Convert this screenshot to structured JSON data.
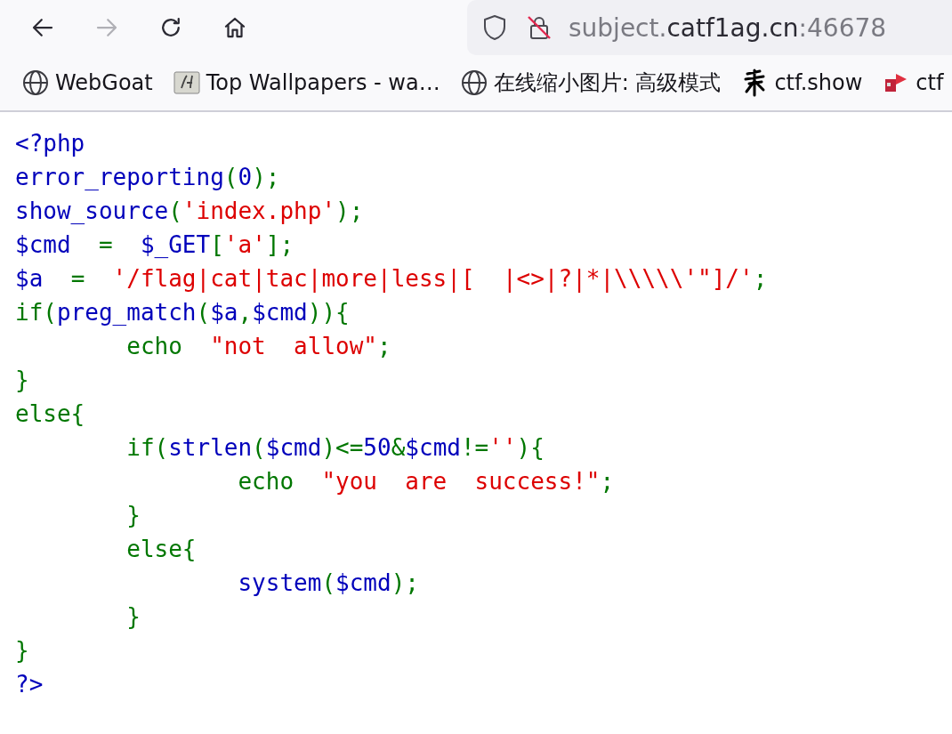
{
  "toolbar": {
    "nav_buttons": [
      {
        "kind": "back",
        "disabled": false
      },
      {
        "kind": "forward",
        "disabled": true
      },
      {
        "kind": "reload",
        "disabled": false
      },
      {
        "kind": "home",
        "disabled": false
      }
    ],
    "address": {
      "insecure": true,
      "prefix": "subject.",
      "host": "catf1ag.cn",
      "port": ":46678"
    }
  },
  "bookmarks": [
    {
      "kind": "globe",
      "label": "WebGoat"
    },
    {
      "kind": "tile",
      "label": "Top Wallpapers - wa…"
    },
    {
      "kind": "globe",
      "label": "在线缩小图片: 高级模式"
    },
    {
      "kind": "glyph",
      "label": "ctf.show"
    },
    {
      "kind": "flag",
      "label": "ctf"
    }
  ],
  "source": [
    [
      {
        "kind": "default",
        "text": "<?php"
      }
    ],
    [
      {
        "kind": "default",
        "text": "error_reporting"
      },
      {
        "kind": "keyword",
        "text": "("
      },
      {
        "kind": "default",
        "text": "0"
      },
      {
        "kind": "keyword",
        "text": ");"
      }
    ],
    [
      {
        "kind": "default",
        "text": "show_source"
      },
      {
        "kind": "keyword",
        "text": "("
      },
      {
        "kind": "string",
        "text": "'index.php'"
      },
      {
        "kind": "keyword",
        "text": ");"
      }
    ],
    [
      {
        "kind": "default",
        "text": "$cmd  "
      },
      {
        "kind": "keyword",
        "text": "=  "
      },
      {
        "kind": "default",
        "text": "$_GET"
      },
      {
        "kind": "keyword",
        "text": "["
      },
      {
        "kind": "string",
        "text": "'a'"
      },
      {
        "kind": "keyword",
        "text": "];"
      }
    ],
    [
      {
        "kind": "default",
        "text": "$a  "
      },
      {
        "kind": "keyword",
        "text": "=  "
      },
      {
        "kind": "string",
        "text": "'/flag|cat|tac|more|less|[  |<>|?|*|\\\\\\\\\\'\"]/'"
      },
      {
        "kind": "keyword",
        "text": ";"
      }
    ],
    [
      {
        "kind": "keyword",
        "text": "if("
      },
      {
        "kind": "default",
        "text": "preg_match"
      },
      {
        "kind": "keyword",
        "text": "("
      },
      {
        "kind": "default",
        "text": "$a"
      },
      {
        "kind": "keyword",
        "text": ","
      },
      {
        "kind": "default",
        "text": "$cmd"
      },
      {
        "kind": "keyword",
        "text": ")){"
      }
    ],
    [
      {
        "kind": "keyword",
        "text": "        echo  "
      },
      {
        "kind": "string",
        "text": "\"not  allow\""
      },
      {
        "kind": "keyword",
        "text": ";"
      }
    ],
    [
      {
        "kind": "keyword",
        "text": "}"
      }
    ],
    [
      {
        "kind": "keyword",
        "text": "else{"
      }
    ],
    [
      {
        "kind": "keyword",
        "text": "        if("
      },
      {
        "kind": "default",
        "text": "strlen"
      },
      {
        "kind": "keyword",
        "text": "("
      },
      {
        "kind": "default",
        "text": "$cmd"
      },
      {
        "kind": "keyword",
        "text": ")<="
      },
      {
        "kind": "default",
        "text": "50"
      },
      {
        "kind": "keyword",
        "text": "&"
      },
      {
        "kind": "default",
        "text": "$cmd"
      },
      {
        "kind": "keyword",
        "text": "!="
      },
      {
        "kind": "string",
        "text": "''"
      },
      {
        "kind": "keyword",
        "text": "){"
      }
    ],
    [
      {
        "kind": "keyword",
        "text": "                echo  "
      },
      {
        "kind": "string",
        "text": "\"you  are  success!\""
      },
      {
        "kind": "keyword",
        "text": ";"
      }
    ],
    [
      {
        "kind": "keyword",
        "text": "        }"
      }
    ],
    [
      {
        "kind": "keyword",
        "text": "        else{"
      }
    ],
    [
      {
        "kind": "default",
        "text": "                system"
      },
      {
        "kind": "keyword",
        "text": "("
      },
      {
        "kind": "default",
        "text": "$cmd"
      },
      {
        "kind": "keyword",
        "text": ");"
      }
    ],
    [
      {
        "kind": "keyword",
        "text": "        }"
      }
    ],
    [
      {
        "kind": "keyword",
        "text": "}"
      }
    ],
    [
      {
        "kind": "default",
        "text": "?>"
      }
    ]
  ]
}
